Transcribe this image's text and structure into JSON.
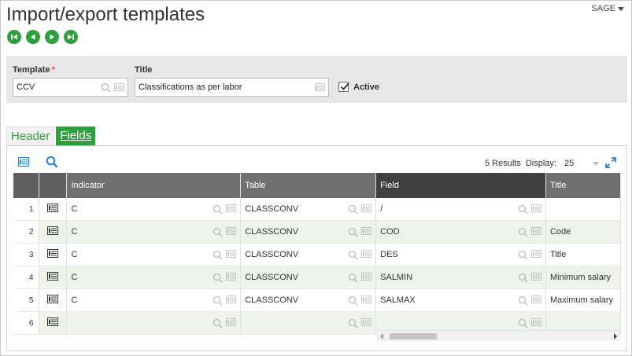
{
  "page": {
    "title": "Import/export templates",
    "menu_label": "SAGE"
  },
  "nav": [
    {
      "name": "first-record-button",
      "icon": "first"
    },
    {
      "name": "previous-record-button",
      "icon": "prev"
    },
    {
      "name": "next-record-button",
      "icon": "next"
    },
    {
      "name": "last-record-button",
      "icon": "last"
    }
  ],
  "criteria": {
    "template_label": "Template",
    "template_required": "*",
    "template_value": "CCV",
    "title_label": "Title",
    "title_value": "Classifications as per labor",
    "active_label": "Active",
    "active_checked": true
  },
  "tabs": {
    "header": "Header",
    "fields": "Fields"
  },
  "toolbar": {
    "results": "5 Results",
    "display_label": "Display:",
    "display_value": "25"
  },
  "grid": {
    "columns": [
      "Indicator",
      "Table",
      "Field",
      "Title"
    ],
    "rows": [
      {
        "num": "1",
        "indicator": "C",
        "table": "CLASSCONV",
        "field": "/",
        "title": ""
      },
      {
        "num": "2",
        "indicator": "C",
        "table": "CLASSCONV",
        "field": "COD",
        "title": "Code"
      },
      {
        "num": "3",
        "indicator": "C",
        "table": "CLASSCONV",
        "field": "DES",
        "title": "Title"
      },
      {
        "num": "4",
        "indicator": "C",
        "table": "CLASSCONV",
        "field": "SALMIN",
        "title": "Minimum salary"
      },
      {
        "num": "5",
        "indicator": "C",
        "table": "CLASSCONV",
        "field": "SALMAX",
        "title": "Maximum salary"
      },
      {
        "num": "6",
        "indicator": "",
        "table": "",
        "field": "",
        "title": ""
      }
    ]
  },
  "colors": {
    "accent": "#2f9e3c",
    "header_bg": "#707070",
    "header_dark": "#3f3f3f",
    "alt_row": "#eef4ea",
    "required": "#e8521e"
  }
}
